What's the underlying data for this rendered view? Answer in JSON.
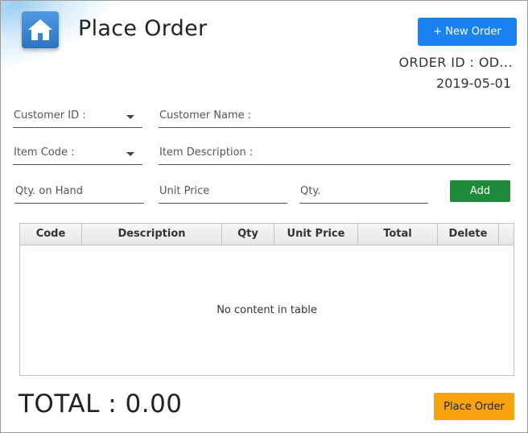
{
  "header": {
    "title": "Place Order",
    "logo_icon": "home-icon",
    "new_order_label": "+ New Order",
    "order_id": "ORDER ID : OD...",
    "order_date": "2019-05-01"
  },
  "form": {
    "customer_id_label": "Customer ID :",
    "customer_name_label": "Customer Name :",
    "item_code_label": "Item Code :",
    "item_description_label": "Item Description :",
    "qty_on_hand_placeholder": "Qty. on Hand",
    "unit_price_placeholder": "Unit Price",
    "qty_placeholder": "Qty.",
    "add_label": "Add"
  },
  "table": {
    "columns": [
      "Code",
      "Description",
      "Qty",
      "Unit Price",
      "Total",
      "Delete"
    ],
    "empty_message": "No content in table"
  },
  "footer": {
    "total_text": "TOTAL : 0.00",
    "place_order_label": "Place Order"
  },
  "colors": {
    "new_order_button": "#1a82f0",
    "add_button": "#1f8a3a",
    "place_order_button": "#f7a30f"
  }
}
